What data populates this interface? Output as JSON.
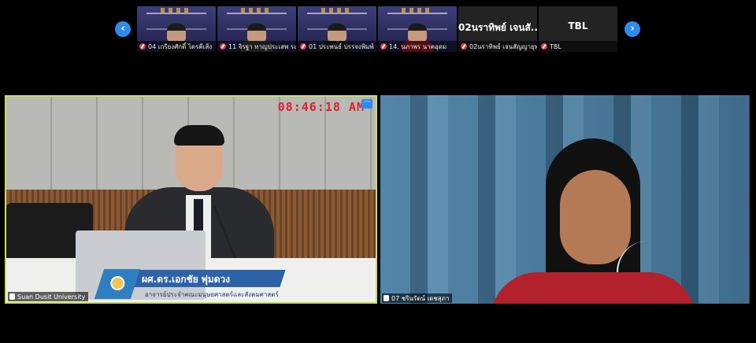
{
  "gallery": {
    "prev_icon": "chevron-left-icon",
    "next_icon": "chevron-right-icon",
    "prev_glyph": "‹",
    "next_glyph": "›",
    "participants": [
      {
        "name": "04 เกรียงศักดิ์  ไตรคีเส้ง",
        "muted": true,
        "type": "video"
      },
      {
        "name": "11 จิรฐา ทาญประเสพ ระบ...",
        "muted": true,
        "type": "video"
      },
      {
        "name": "01 ประพนธ์ บรรจงพิมพ์",
        "muted": true,
        "type": "video"
      },
      {
        "name": "14. นภาพร  นาคอุดม",
        "muted": true,
        "type": "video"
      },
      {
        "name": "02นราทิพย์ เจนสัญญายุทธ",
        "muted": true,
        "type": "name",
        "tile_title": "02นราทิพย์ เจนสั..."
      },
      {
        "name": "TBL",
        "muted": true,
        "type": "name",
        "tile_title": "TBL"
      }
    ]
  },
  "main_video": {
    "timestamp": "08:46:18 AM",
    "more_glyph": "···",
    "lower_third_name": "ผศ.ดร.เอกชัย พุ่มดวง",
    "lower_third_title": "อาจารย์ประจำคณะมนุษยศาสตร์และสังคมศาสตร์",
    "label": "Suan Dusit University",
    "active_speaker_border": "#c7e05a"
  },
  "side_video": {
    "label": "07 ชรินรัตน์ เดชสุภา"
  },
  "colors": {
    "accent": "#2e8cf0",
    "muted": "#e03b3b",
    "timestamp": "#e0202a"
  }
}
